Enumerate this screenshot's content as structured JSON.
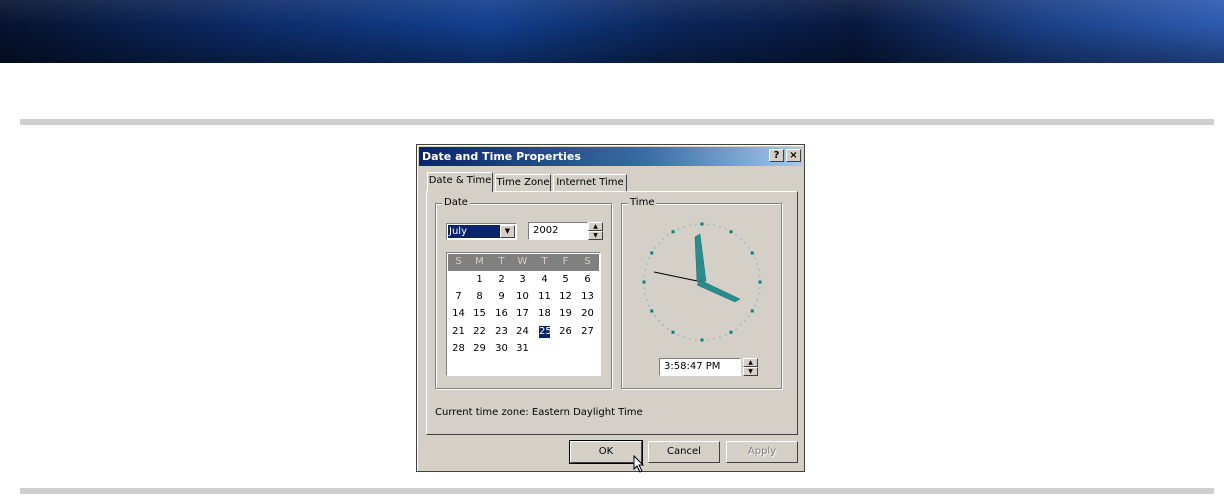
{
  "dialog": {
    "title": "Date and Time Properties",
    "help_label": "?",
    "close_label": "×"
  },
  "tabs": [
    {
      "label": "Date & Time"
    },
    {
      "label": "Time Zone"
    },
    {
      "label": "Internet Time"
    }
  ],
  "date_group": {
    "label": "Date",
    "month": "July",
    "year": "2002",
    "weekdays": [
      "S",
      "M",
      "T",
      "W",
      "T",
      "F",
      "S"
    ],
    "days": [
      "1",
      "2",
      "3",
      "4",
      "5",
      "6",
      "7",
      "8",
      "9",
      "10",
      "11",
      "12",
      "13",
      "14",
      "15",
      "16",
      "17",
      "18",
      "19",
      "20",
      "21",
      "22",
      "23",
      "24",
      "25",
      "26",
      "27",
      "28",
      "29",
      "30",
      "31"
    ],
    "selected_day": "25"
  },
  "time_group": {
    "label": "Time",
    "time_value": "3:58:47 PM"
  },
  "status": {
    "timezone_text": "Current time zone:  Eastern Daylight Time"
  },
  "buttons": {
    "ok": "OK",
    "cancel": "Cancel",
    "apply": "Apply"
  }
}
